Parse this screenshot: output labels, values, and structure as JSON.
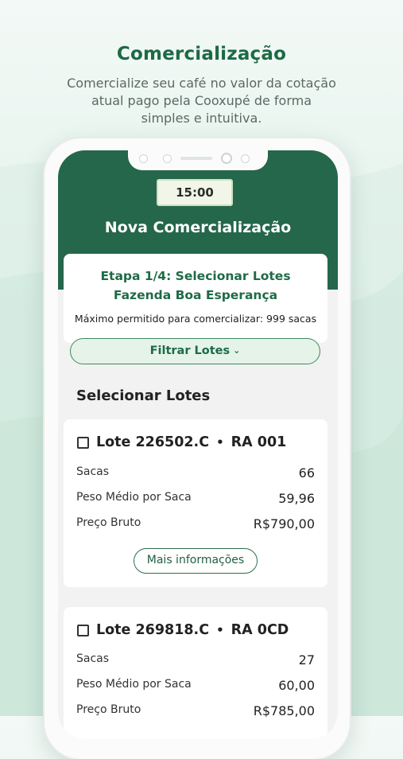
{
  "header": {
    "title": "Comercialização",
    "subtitle_lines": [
      "Comercialize seu café no valor da cotação",
      "atual pago pela Cooxupé de forma",
      "simples e intuitiva."
    ]
  },
  "status": {
    "time": "15:00"
  },
  "screen": {
    "title": "Nova Comercialização",
    "step": "Etapa 1/4: Selecionar Lotes",
    "farm": "Fazenda Boa Esperança",
    "max_text": "Máximo permitido para comercializar: 999 sacas",
    "filter_label": "Filtrar Lotes",
    "filter_icon": "chevron-down-icon",
    "section_title": "Selecionar Lotes",
    "more_label": "Mais informações"
  },
  "lots": [
    {
      "lote": "Lote 226502.C",
      "ra": "RA 001",
      "rows": [
        {
          "label": "Sacas",
          "value": "66"
        },
        {
          "label": "Peso Médio por Saca",
          "value": "59,96"
        },
        {
          "label": "Preço Bruto",
          "value": "R$790,00"
        }
      ]
    },
    {
      "lote": "Lote 269818.C",
      "ra": "RA 0CD",
      "rows": [
        {
          "label": "Sacas",
          "value": "27"
        },
        {
          "label": "Peso Médio por Saca",
          "value": "60,00"
        },
        {
          "label": "Preço Bruto",
          "value": "R$785,00"
        }
      ]
    }
  ],
  "colors": {
    "brand": "#24674a",
    "accent": "#1f6b46",
    "chip_bg": "#e5f3e8"
  }
}
